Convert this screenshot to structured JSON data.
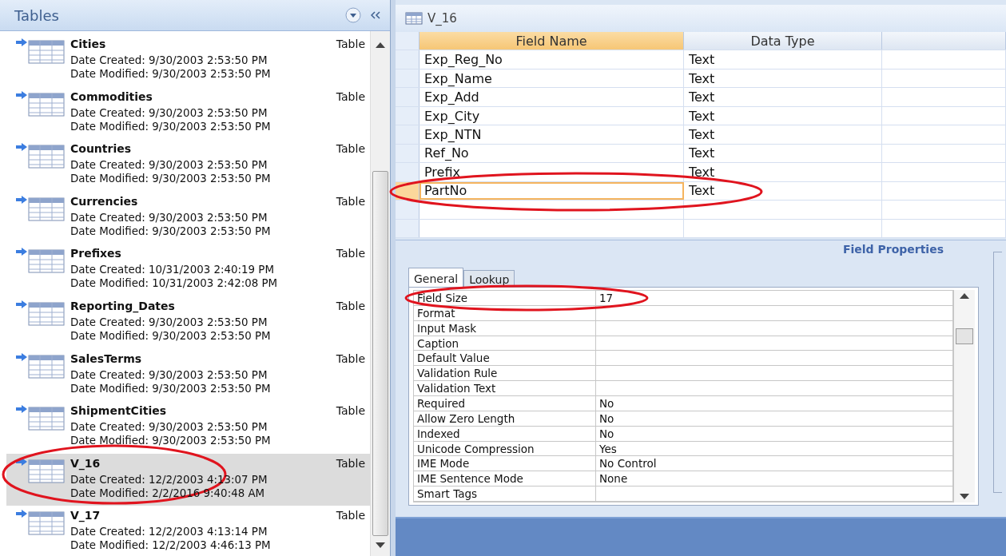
{
  "nav_pane": {
    "title": "Tables",
    "items": [
      {
        "name": "Cities",
        "type": "Table",
        "created": "Date Created: 9/30/2003 2:53:50 PM",
        "modified": "Date Modified: 9/30/2003 2:53:50 PM",
        "selected": false,
        "circled": false
      },
      {
        "name": "Commodities",
        "type": "Table",
        "created": "Date Created: 9/30/2003 2:53:50 PM",
        "modified": "Date Modified: 9/30/2003 2:53:50 PM",
        "selected": false,
        "circled": false
      },
      {
        "name": "Countries",
        "type": "Table",
        "created": "Date Created: 9/30/2003 2:53:50 PM",
        "modified": "Date Modified: 9/30/2003 2:53:50 PM",
        "selected": false,
        "circled": false
      },
      {
        "name": "Currencies",
        "type": "Table",
        "created": "Date Created: 9/30/2003 2:53:50 PM",
        "modified": "Date Modified: 9/30/2003 2:53:50 PM",
        "selected": false,
        "circled": false
      },
      {
        "name": "Prefixes",
        "type": "Table",
        "created": "Date Created: 10/31/2003 2:40:19 PM",
        "modified": "Date Modified: 10/31/2003 2:42:08 PM",
        "selected": false,
        "circled": false
      },
      {
        "name": "Reporting_Dates",
        "type": "Table",
        "created": "Date Created: 9/30/2003 2:53:50 PM",
        "modified": "Date Modified: 9/30/2003 2:53:50 PM",
        "selected": false,
        "circled": false
      },
      {
        "name": "SalesTerms",
        "type": "Table",
        "created": "Date Created: 9/30/2003 2:53:50 PM",
        "modified": "Date Modified: 9/30/2003 2:53:50 PM",
        "selected": false,
        "circled": false
      },
      {
        "name": "ShipmentCities",
        "type": "Table",
        "created": "Date Created: 9/30/2003 2:53:50 PM",
        "modified": "Date Modified: 9/30/2003 2:53:50 PM",
        "selected": false,
        "circled": false
      },
      {
        "name": "V_16",
        "type": "Table",
        "created": "Date Created: 12/2/2003 4:13:07 PM",
        "modified": "Date Modified: 2/2/2016 9:40:48 AM",
        "selected": true,
        "circled": true
      },
      {
        "name": "V_17",
        "type": "Table",
        "created": "Date Created: 12/2/2003 4:13:14 PM",
        "modified": "Date Modified: 12/2/2003 4:46:13 PM",
        "selected": false,
        "circled": false
      }
    ]
  },
  "design": {
    "title": "V_16",
    "columns": [
      "Field Name",
      "Data Type"
    ],
    "rows": [
      {
        "field": "Exp_Reg_No",
        "type": "Text",
        "selected": false,
        "circled": false
      },
      {
        "field": "Exp_Name",
        "type": "Text",
        "selected": false,
        "circled": false
      },
      {
        "field": "Exp_Add",
        "type": "Text",
        "selected": false,
        "circled": false
      },
      {
        "field": "Exp_City",
        "type": "Text",
        "selected": false,
        "circled": false
      },
      {
        "field": "Exp_NTN",
        "type": "Text",
        "selected": false,
        "circled": false
      },
      {
        "field": "Ref_No",
        "type": "Text",
        "selected": false,
        "circled": false
      },
      {
        "field": "Prefix",
        "type": "Text",
        "selected": false,
        "circled": false
      },
      {
        "field": "PartNo",
        "type": "Text",
        "selected": true,
        "circled": true
      }
    ]
  },
  "field_properties": {
    "title": "Field Properties",
    "tabs": [
      {
        "label": "General",
        "selected": true
      },
      {
        "label": "Lookup",
        "selected": false
      }
    ],
    "properties": [
      {
        "name": "Field Size",
        "value": "17",
        "circled": true
      },
      {
        "name": "Format",
        "circled": false
      },
      {
        "name": "Input Mask",
        "circled": false
      },
      {
        "name": "Caption",
        "circled": false
      },
      {
        "name": "Default Value",
        "circled": false
      },
      {
        "name": "Validation Rule",
        "circled": false
      },
      {
        "name": "Validation Text",
        "circled": false
      },
      {
        "name": "Required",
        "value": "No",
        "circled": false
      },
      {
        "name": "Allow Zero Length",
        "value": "No",
        "circled": false
      },
      {
        "name": "Indexed",
        "value": "No",
        "circled": false
      },
      {
        "name": "Unicode Compression",
        "value": "Yes",
        "circled": false
      },
      {
        "name": "IME Mode",
        "value": "No Control",
        "circled": false
      },
      {
        "name": "IME Sentence Mode",
        "value": "None",
        "circled": false
      },
      {
        "name": "Smart Tags",
        "circled": false
      }
    ]
  }
}
